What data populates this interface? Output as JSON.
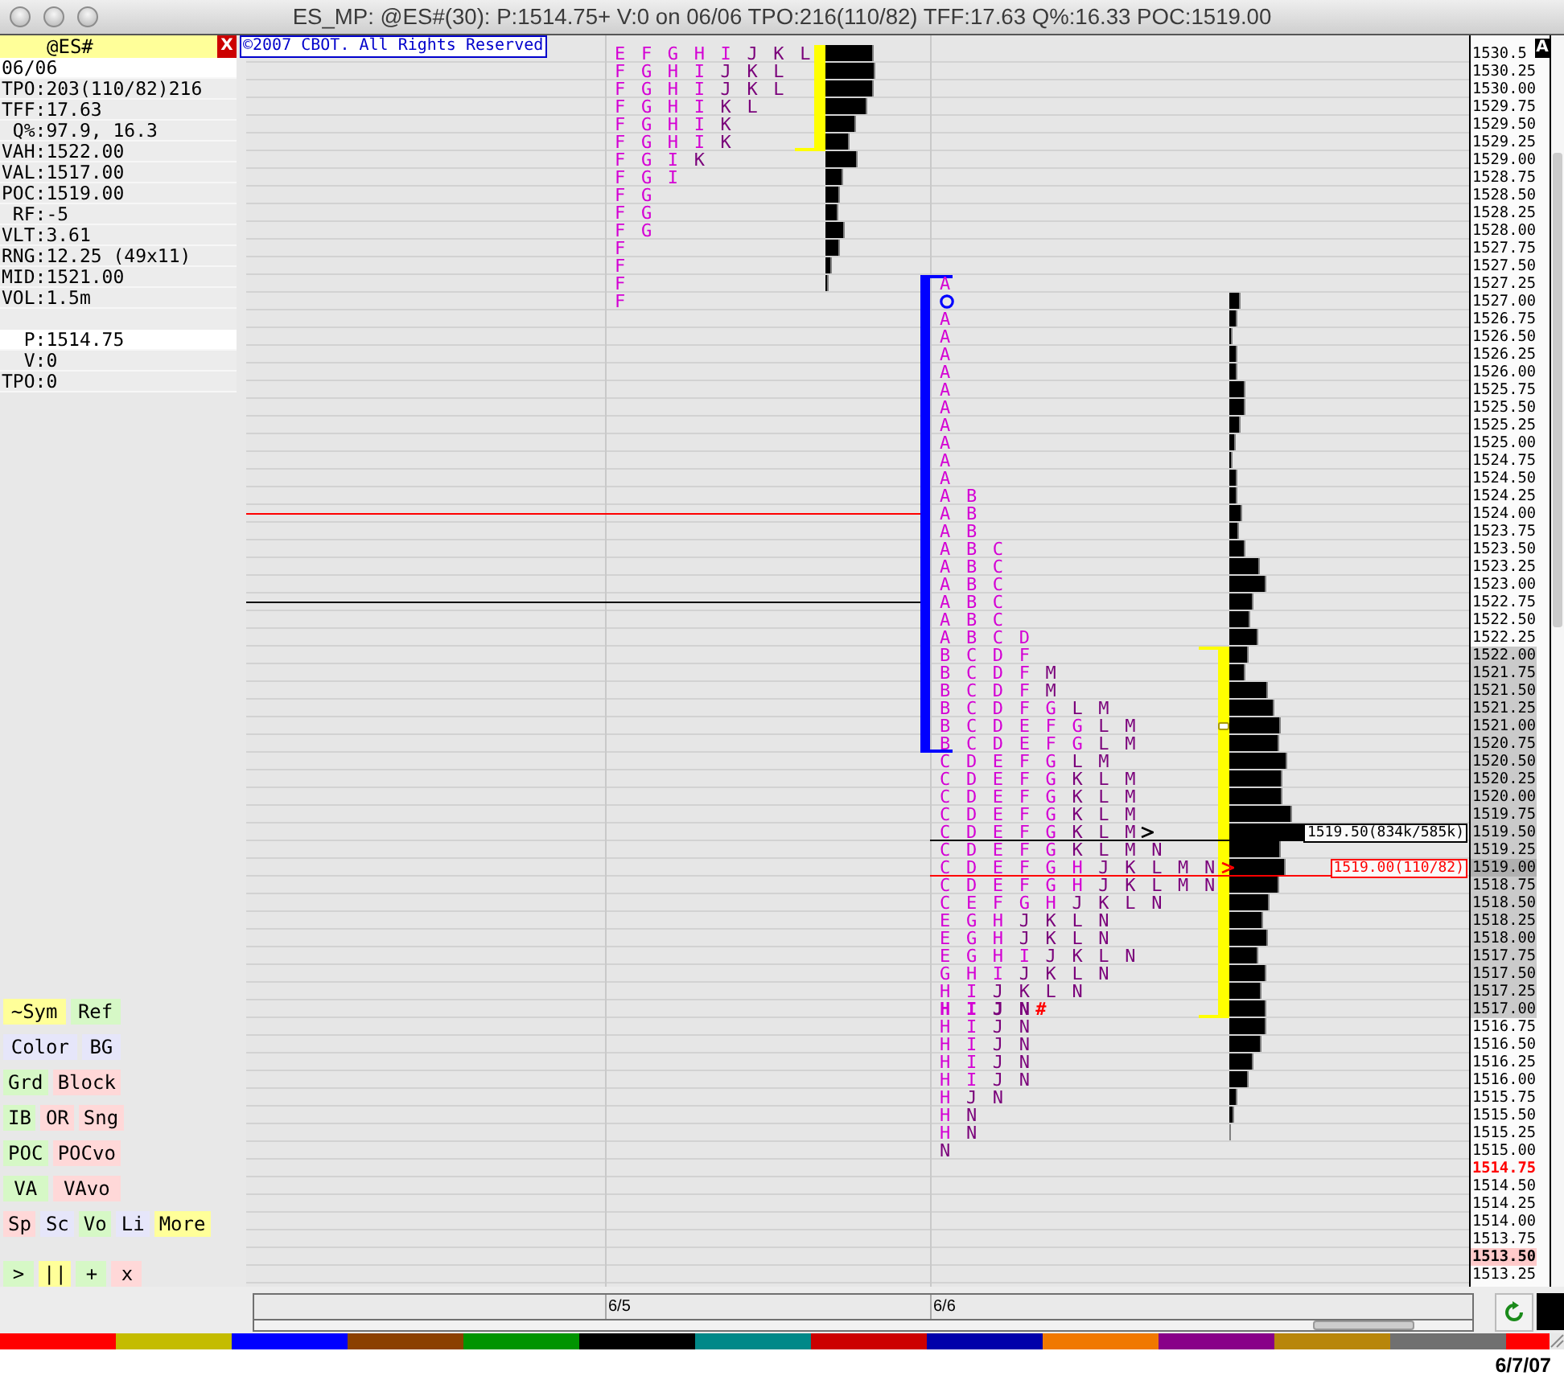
{
  "window": {
    "title": "ES_MP: @ES#(30): P:1514.75+ V:0 on 06/06 TPO:216(110/82) TFF:17.63 Q%:16.33 POC:1519.00"
  },
  "symbol_panel": {
    "symbol": "@ES#",
    "close_label": "X",
    "session_stats": [
      {
        "value": "06/06",
        "highlighted": true
      },
      {
        "label": "TPO:",
        "value": "203(110/82)216",
        "highlighted": false
      },
      {
        "label": "TFF:",
        "value": "17.63",
        "highlighted": false
      },
      {
        "label": "Q%:",
        "value": "97.9, 16.3",
        "highlighted": false
      },
      {
        "label": "VAH:",
        "value": "1522.00",
        "highlighted": false
      },
      {
        "label": "VAL:",
        "value": "1517.00",
        "highlighted": false
      },
      {
        "label": "POC:",
        "value": "1519.00",
        "highlighted": false
      },
      {
        "label": "RF:",
        "value": "-5",
        "highlighted": false
      },
      {
        "label": "VLT:",
        "value": "3.61",
        "highlighted": false
      },
      {
        "label": "RNG:",
        "value": "12.25 (49x11)",
        "highlighted": false
      },
      {
        "label": "MID:",
        "value": "1521.00",
        "highlighted": false
      },
      {
        "label": "VOL:",
        "value": "1.5m",
        "highlighted": false
      }
    ],
    "live_stats": [
      {
        "label": "P:",
        "value": "1514.75",
        "highlighted": true
      },
      {
        "label": "V:",
        "value": "0",
        "highlighted": false
      },
      {
        "label": "TPO:",
        "value": "0",
        "highlighted": false
      }
    ],
    "tool_buttons": [
      [
        {
          "label": "~Sym",
          "color": "#ffff99"
        },
        {
          "label": "Ref",
          "color": "#d6f8c6"
        }
      ],
      [
        {
          "label": "Color",
          "color": "#e6e6fa"
        },
        {
          "label": "BG",
          "color": "#e6e6fa"
        }
      ],
      [
        {
          "label": "Grd",
          "color": "#d6f8c6"
        },
        {
          "label": "Block",
          "color": "#ffd8d8"
        }
      ],
      [
        {
          "label": "IB",
          "color": "#d6f8c6"
        },
        {
          "label": "OR",
          "color": "#ffd8d8"
        },
        {
          "label": "Sng",
          "color": "#ffd8d8"
        }
      ],
      [
        {
          "label": "POC",
          "color": "#d6f8c6"
        },
        {
          "label": "POCvo",
          "color": "#ffd8d8"
        }
      ],
      [
        {
          "label": "VA",
          "color": "#d6f8c6"
        },
        {
          "label": "VAvo",
          "color": "#ffd8d8"
        }
      ],
      [
        {
          "label": "Sp",
          "color": "#ffd8d8"
        },
        {
          "label": "Sc",
          "color": "#e6e6fa"
        },
        {
          "label": "Vo",
          "color": "#d6f8c6"
        },
        {
          "label": "Li",
          "color": "#e6e6fa"
        },
        {
          "label": "More",
          "color": "#ffff99"
        }
      ]
    ],
    "playback_buttons": [
      {
        "label": ">",
        "color": "#d6f8c6"
      },
      {
        "label": "||",
        "color": "#ffff99"
      },
      {
        "label": "+",
        "color": "#d6f8c6"
      },
      {
        "label": "x",
        "color": "#ffd8d8"
      }
    ]
  },
  "chart": {
    "copyright": "©2007 CBOT. All Rights Reserved",
    "axis_badge": "A",
    "sessions": [
      {
        "date": "6/5"
      },
      {
        "date": "6/6"
      }
    ],
    "rows": [
      {
        "price": "1530.5",
        "kind": "plain",
        "prior_day": {
          "kind": "tpo",
          "early": "E F G H I",
          "late": "J K L",
          "va": true
        }
      },
      {
        "price": "1530.25",
        "kind": "plain",
        "prior_day": {
          "kind": "tpo",
          "early": "F G H I",
          "late": "J K L",
          "va": true
        }
      },
      {
        "price": "1530.00",
        "kind": "plain",
        "prior_day": {
          "kind": "tpo",
          "early": "F G H I",
          "late": "J K L",
          "va": true
        }
      },
      {
        "price": "1529.75",
        "kind": "plain",
        "prior_day": {
          "kind": "tpo",
          "early": "F G H I",
          "late": "K L",
          "va": true
        }
      },
      {
        "price": "1529.50",
        "kind": "plain",
        "prior_day": {
          "kind": "tpo",
          "early": "F G H I",
          "late": "K",
          "va": true
        }
      },
      {
        "price": "1529.25",
        "kind": "plain",
        "prior_day": {
          "kind": "tpo",
          "early": "F G H I",
          "late": "K",
          "va": true
        }
      },
      {
        "price": "1529.00",
        "kind": "plain",
        "prior_day": {
          "kind": "tpo",
          "early": "F G I",
          "late": "K",
          "va": false
        }
      },
      {
        "price": "1528.75",
        "kind": "plain",
        "prior_day": {
          "kind": "tpo",
          "early": "F G I",
          "va": false
        }
      },
      {
        "price": "1528.50",
        "kind": "plain",
        "prior_day": {
          "kind": "tpo",
          "early": "F G",
          "va": false
        }
      },
      {
        "price": "1528.25",
        "kind": "plain",
        "prior_day": {
          "kind": "tpo",
          "early": "F G",
          "va": false
        }
      },
      {
        "price": "1528.00",
        "kind": "plain",
        "prior_day": {
          "kind": "tpo",
          "early": "F G",
          "va": false
        }
      },
      {
        "price": "1527.75",
        "kind": "plain",
        "prior_day": {
          "kind": "tpo",
          "early": "F",
          "va": false
        }
      },
      {
        "price": "1527.50",
        "kind": "plain",
        "prior_day": {
          "kind": "tpo",
          "early": "F",
          "va": false
        }
      },
      {
        "price": "1527.25",
        "kind": "plain",
        "prior_day": {
          "kind": "tpo",
          "early": "F",
          "va": false
        },
        "current_day": {
          "kind": "tpo",
          "early": "A",
          "ib": true,
          "va": false,
          "mid": false
        }
      },
      {
        "price": "1527.00",
        "kind": "plain",
        "prior_day": {
          "kind": "tpo",
          "early": "F",
          "va": false
        },
        "current_day": {
          "kind": "open",
          "ib": true,
          "va": false,
          "mid": false
        }
      },
      {
        "price": "1526.75",
        "kind": "plain",
        "current_day": {
          "kind": "tpo",
          "early": "A",
          "ib": true,
          "va": false,
          "mid": false
        }
      },
      {
        "price": "1526.50",
        "kind": "plain",
        "current_day": {
          "kind": "tpo",
          "early": "A",
          "ib": true,
          "va": false,
          "mid": false
        }
      },
      {
        "price": "1526.25",
        "kind": "plain",
        "current_day": {
          "kind": "tpo",
          "early": "A",
          "ib": true,
          "va": false,
          "mid": false
        }
      },
      {
        "price": "1526.00",
        "kind": "plain",
        "current_day": {
          "kind": "tpo",
          "early": "A",
          "ib": true,
          "va": false,
          "mid": false
        }
      },
      {
        "price": "1525.75",
        "kind": "plain",
        "current_day": {
          "kind": "tpo",
          "early": "A",
          "ib": true,
          "va": false,
          "mid": false
        }
      },
      {
        "price": "1525.50",
        "kind": "plain",
        "current_day": {
          "kind": "tpo",
          "early": "A",
          "ib": true,
          "va": false,
          "mid": false
        }
      },
      {
        "price": "1525.25",
        "kind": "plain",
        "current_day": {
          "kind": "tpo",
          "early": "A",
          "ib": true,
          "va": false,
          "mid": false
        }
      },
      {
        "price": "1525.00",
        "kind": "plain",
        "current_day": {
          "kind": "tpo",
          "early": "A",
          "ib": true,
          "va": false,
          "mid": false
        }
      },
      {
        "price": "1524.75",
        "kind": "plain",
        "current_day": {
          "kind": "tpo",
          "early": "A",
          "ib": true,
          "va": false,
          "mid": false
        }
      },
      {
        "price": "1524.50",
        "kind": "plain",
        "current_day": {
          "kind": "tpo",
          "early": "A",
          "ib": true,
          "va": false,
          "mid": false
        }
      },
      {
        "price": "1524.25",
        "kind": "plain",
        "current_day": {
          "kind": "tpo",
          "early": "A B",
          "ib": true,
          "va": false,
          "mid": false
        }
      },
      {
        "price": "1524.00",
        "kind": "plain",
        "current_day": {
          "kind": "tpo",
          "early": "A B",
          "ib": true,
          "va": false,
          "mid": false,
          "guide": {
            "color": "#ff0000"
          }
        }
      },
      {
        "price": "1523.75",
        "kind": "plain",
        "current_day": {
          "kind": "tpo",
          "early": "A B",
          "ib": true,
          "va": false,
          "mid": false
        }
      },
      {
        "price": "1523.50",
        "kind": "plain",
        "current_day": {
          "kind": "tpo",
          "early": "A B C",
          "ib": true,
          "va": false,
          "mid": false
        }
      },
      {
        "price": "1523.25",
        "kind": "plain",
        "current_day": {
          "kind": "tpo",
          "early": "A B C",
          "ib": true,
          "va": false,
          "mid": false
        }
      },
      {
        "price": "1523.00",
        "kind": "plain",
        "current_day": {
          "kind": "tpo",
          "early": "A B C",
          "ib": true,
          "va": false,
          "mid": false
        }
      },
      {
        "price": "1522.75",
        "kind": "plain",
        "current_day": {
          "kind": "tpo",
          "early": "A B C",
          "ib": true,
          "va": false,
          "mid": false,
          "guide": {
            "color": "#000000"
          }
        }
      },
      {
        "price": "1522.50",
        "kind": "plain",
        "current_day": {
          "kind": "tpo",
          "early": "A B C",
          "ib": true,
          "va": false,
          "mid": false
        }
      },
      {
        "price": "1522.25",
        "kind": "plain",
        "current_day": {
          "kind": "tpo",
          "early": "A B C D",
          "ib": true,
          "va": false,
          "mid": false
        }
      },
      {
        "price": "1522.00",
        "kind": "value_area",
        "current_day": {
          "kind": "tpo",
          "early": "B C D F",
          "ib": true,
          "va": true,
          "mid": false
        }
      },
      {
        "price": "1521.75",
        "kind": "value_area",
        "current_day": {
          "kind": "tpo",
          "early": "B C D F",
          "late": "M",
          "ib": true,
          "va": true,
          "mid": false
        }
      },
      {
        "price": "1521.50",
        "kind": "value_area",
        "current_day": {
          "kind": "tpo",
          "early": "B C D F",
          "late": "M",
          "ib": true,
          "va": true,
          "mid": false
        }
      },
      {
        "price": "1521.25",
        "kind": "value_area",
        "current_day": {
          "kind": "tpo",
          "early": "B C D F G",
          "late": "L M",
          "ib": true,
          "va": true,
          "mid": false
        }
      },
      {
        "price": "1521.00",
        "kind": "value_area",
        "current_day": {
          "kind": "tpo",
          "early": "B C D E F G",
          "late": "L M",
          "ib": true,
          "va": true,
          "mid": true
        }
      },
      {
        "price": "1520.75",
        "kind": "value_area",
        "current_day": {
          "kind": "tpo",
          "early": "B C D E F G",
          "late": "L M",
          "ib": true,
          "va": true,
          "mid": false
        }
      },
      {
        "price": "1520.50",
        "kind": "value_area",
        "current_day": {
          "kind": "tpo",
          "early": "C D E F G",
          "late": "L M",
          "ib": false,
          "va": true,
          "mid": false
        }
      },
      {
        "price": "1520.25",
        "kind": "value_area",
        "current_day": {
          "kind": "tpo",
          "early": "C D E F G",
          "late": "K L M",
          "ib": false,
          "va": true,
          "mid": false
        }
      },
      {
        "price": "1520.00",
        "kind": "value_area",
        "current_day": {
          "kind": "tpo",
          "early": "C D E F G",
          "late": "K L M",
          "ib": false,
          "va": true,
          "mid": false
        }
      },
      {
        "price": "1519.75",
        "kind": "value_area",
        "current_day": {
          "kind": "tpo",
          "early": "C D E F G",
          "late": "K L M",
          "ib": false,
          "va": true,
          "mid": false
        }
      },
      {
        "price": "1519.50",
        "kind": "value_area",
        "current_day": {
          "kind": "tpo",
          "early": "C D E F G",
          "late": "K L M",
          "ib": false,
          "va": true,
          "mid": false,
          "callout": {
            "text": "1519.50(834k/585k)",
            "color": "#000000"
          }
        }
      },
      {
        "price": "1519.25",
        "kind": "value_area",
        "current_day": {
          "kind": "tpo",
          "early": "C D E F G",
          "late": "K L M N",
          "ib": false,
          "va": true,
          "mid": false
        }
      },
      {
        "price": "1519.00",
        "kind": "poc",
        "current_day": {
          "kind": "tpo",
          "early": "C D E F G H",
          "late": "J K L M N",
          "ib": false,
          "va": true,
          "mid": false,
          "callout": {
            "text": "1519.00(110/82)",
            "color": "#ff0000"
          }
        }
      },
      {
        "price": "1518.75",
        "kind": "value_area",
        "current_day": {
          "kind": "tpo",
          "early": "C D E F G H",
          "late": "J K L M N",
          "ib": false,
          "va": true,
          "mid": false
        }
      },
      {
        "price": "1518.50",
        "kind": "value_area",
        "current_day": {
          "kind": "tpo",
          "early": "C E F G H",
          "late": "J K L N",
          "ib": false,
          "va": true,
          "mid": false
        }
      },
      {
        "price": "1518.25",
        "kind": "value_area",
        "current_day": {
          "kind": "tpo",
          "early": "E G H",
          "late": "J K L N",
          "ib": false,
          "va": true,
          "mid": false
        }
      },
      {
        "price": "1518.00",
        "kind": "value_area",
        "current_day": {
          "kind": "tpo",
          "early": "E G H",
          "late": "J K L N",
          "ib": false,
          "va": true,
          "mid": false
        }
      },
      {
        "price": "1517.75",
        "kind": "value_area",
        "current_day": {
          "kind": "tpo",
          "early": "E G H I",
          "late": "J K L N",
          "ib": false,
          "va": true,
          "mid": false
        }
      },
      {
        "price": "1517.50",
        "kind": "value_area",
        "current_day": {
          "kind": "tpo",
          "early": "G H I",
          "late": "J K L N",
          "ib": false,
          "va": true,
          "mid": false
        }
      },
      {
        "price": "1517.25",
        "kind": "value_area",
        "current_day": {
          "kind": "tpo",
          "early": "H I",
          "late": "J K L N",
          "ib": false,
          "va": true,
          "mid": false
        }
      },
      {
        "price": "1517.00",
        "kind": "value_area",
        "current_day": {
          "kind": "marked",
          "early": "H I",
          "late": "J N",
          "mark": "#",
          "ib": false,
          "va": true,
          "mid": false
        }
      },
      {
        "price": "1516.75",
        "kind": "plain",
        "current_day": {
          "kind": "tpo",
          "early": "H I",
          "late": "J N",
          "ib": false,
          "va": false,
          "mid": false
        }
      },
      {
        "price": "1516.50",
        "kind": "plain",
        "current_day": {
          "kind": "tpo",
          "early": "H I",
          "late": "J N",
          "ib": false,
          "va": false,
          "mid": false
        }
      },
      {
        "price": "1516.25",
        "kind": "plain",
        "current_day": {
          "kind": "tpo",
          "early": "H I",
          "late": "J N",
          "ib": false,
          "va": false,
          "mid": false
        }
      },
      {
        "price": "1516.00",
        "kind": "plain",
        "current_day": {
          "kind": "tpo",
          "early": "H I",
          "late": "J N",
          "ib": false,
          "va": false,
          "mid": false
        }
      },
      {
        "price": "1515.75",
        "kind": "plain",
        "current_day": {
          "kind": "tpo",
          "early": "H",
          "late": "J N",
          "ib": false,
          "va": false,
          "mid": false
        }
      },
      {
        "price": "1515.50",
        "kind": "plain",
        "current_day": {
          "kind": "tpo",
          "early": "H",
          "late": "N",
          "ib": false,
          "va": false,
          "mid": false
        }
      },
      {
        "price": "1515.25",
        "kind": "plain",
        "current_day": {
          "kind": "tpo",
          "early": "H",
          "late": "N",
          "ib": false,
          "va": false,
          "mid": false
        }
      },
      {
        "price": "1515.00",
        "kind": "plain",
        "current_day": {
          "kind": "tpo",
          "late": "N",
          "ib": false,
          "va": false,
          "mid": false
        }
      },
      {
        "price": "1514.75",
        "kind": "last"
      },
      {
        "price": "1514.50",
        "kind": "plain"
      },
      {
        "price": "1514.25",
        "kind": "plain"
      },
      {
        "price": "1514.00",
        "kind": "plain"
      },
      {
        "price": "1513.75",
        "kind": "plain"
      },
      {
        "price": "1513.50",
        "kind": "marked"
      },
      {
        "price": "1513.25",
        "kind": "plain"
      }
    ]
  },
  "palette": [
    {
      "color": "#ff0000"
    },
    {
      "color": "#c4bc00"
    },
    {
      "color": "#0000ff"
    },
    {
      "color": "#8b4000"
    },
    {
      "color": "#009400"
    },
    {
      "color": "#000000"
    },
    {
      "color": "#008888"
    },
    {
      "color": "#cc0000"
    },
    {
      "color": "#0000aa"
    },
    {
      "color": "#f07800"
    },
    {
      "color": "#880088"
    },
    {
      "color": "#b8860b"
    },
    {
      "color": "#707070"
    },
    {
      "color": "#ff0000"
    }
  ],
  "status_date": "6/7/07"
}
